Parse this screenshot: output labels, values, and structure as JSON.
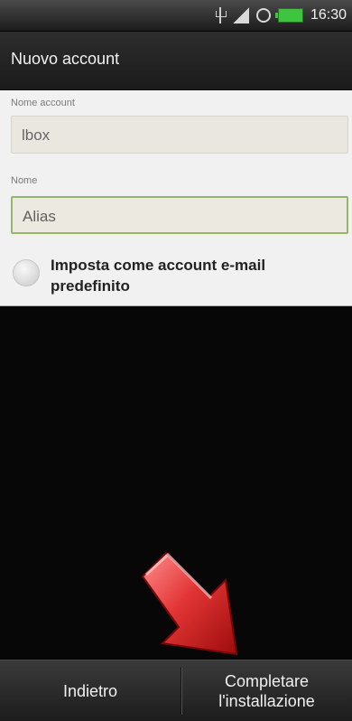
{
  "status_bar": {
    "time": "16:30",
    "icons": [
      "usb-icon",
      "signal-icon",
      "alarm-icon",
      "battery-icon"
    ],
    "battery_color": "#3fc43f"
  },
  "title_bar": {
    "title": "Nuovo account"
  },
  "form": {
    "account_name_label": "Nome account",
    "account_name_value": "lbox",
    "name_label": "Nome",
    "name_value": "Alias",
    "default_checkbox_label": "Imposta come account e-mail predefinito",
    "default_checkbox_checked": false
  },
  "overlay": {
    "arrow_icon": "red-diagonal-arrow-icon",
    "arrow_color": "#d81f1f"
  },
  "bottom_bar": {
    "back_label": "Indietro",
    "complete_label": "Completare l'installazione"
  }
}
